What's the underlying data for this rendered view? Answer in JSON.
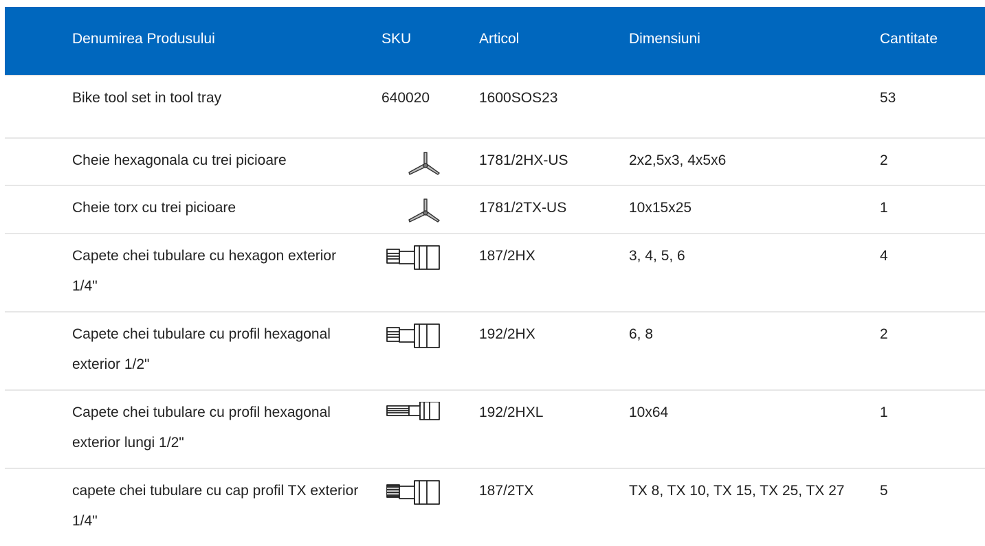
{
  "header": {
    "name": "Denumirea Produsului",
    "sku": "SKU",
    "article": "Articol",
    "dimensions": "Dimensiuni",
    "quantity": "Cantitate"
  },
  "rows": [
    {
      "name": "Bike tool set in tool tray",
      "sku": "640020",
      "icon": null,
      "article": "1600SOS23",
      "dimensions": "",
      "quantity": "53"
    },
    {
      "name": "Cheie hexagonala cu trei picioare",
      "sku": "",
      "icon": "three-leg-hex-key-icon",
      "article": "1781/2HX-US",
      "dimensions": "2x2,5x3, 4x5x6",
      "quantity": "2"
    },
    {
      "name": "Cheie torx cu trei picioare",
      "sku": "",
      "icon": "three-leg-torx-key-icon",
      "article": "1781/2TX-US",
      "dimensions": "10x15x25",
      "quantity": "1"
    },
    {
      "name": "Capete chei tubulare cu hexagon exterior 1/4\"",
      "sku": "",
      "icon": "hex-socket-bit-icon",
      "article": "187/2HX",
      "dimensions": "3, 4, 5, 6",
      "quantity": "4"
    },
    {
      "name": "Capete chei tubulare cu profil hexagonal exterior 1/2\"",
      "sku": "",
      "icon": "hex-socket-bit-icon",
      "article": "192/2HX",
      "dimensions": "6, 8",
      "quantity": "2"
    },
    {
      "name": "Capete chei tubulare cu profil hexagonal exterior lungi 1/2\"",
      "sku": "",
      "icon": "long-hex-socket-bit-icon",
      "article": "192/2HXL",
      "dimensions": "10x64",
      "quantity": "1"
    },
    {
      "name": "capete chei tubulare cu cap profil TX exterior 1/4\"",
      "sku": "",
      "icon": "torx-socket-bit-icon",
      "article": "187/2TX",
      "dimensions": "TX 8, TX 10, TX 15, TX 25, TX 27",
      "quantity": "5"
    }
  ]
}
